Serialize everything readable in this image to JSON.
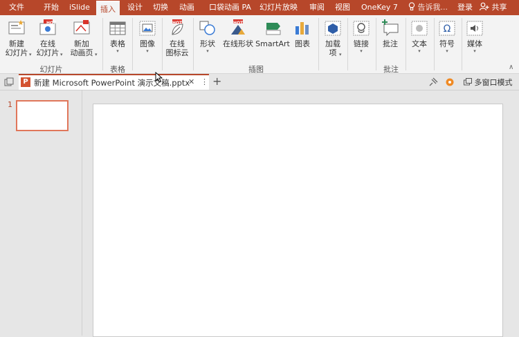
{
  "menu": {
    "tabs": [
      "文件",
      "开始",
      "iSlide",
      "插入",
      "设计",
      "切换",
      "动画",
      "口袋动画 PA",
      "幻灯片放映",
      "审阅",
      "视图",
      "OneKey 7"
    ],
    "active_tab": "插入",
    "tell_me": "告诉我...",
    "login": "登录",
    "share": "共享"
  },
  "ribbon": {
    "new_slide": [
      "新建",
      "幻灯片"
    ],
    "online_slide": [
      "在线",
      "幻灯片"
    ],
    "new_anim_page": [
      "新加",
      "动画页"
    ],
    "group_slides": "幻灯片",
    "table": "表格",
    "group_table": "表格",
    "image": "图像",
    "online_icons": [
      "在线",
      "图标云"
    ],
    "shapes": "形状",
    "online_shapes": "在线形状",
    "smartart": "SmartArt",
    "chart": "图表",
    "group_illustrations": "插图",
    "addins": [
      "加载",
      "项"
    ],
    "links": "链接",
    "comment": "批注",
    "group_comments": "批注",
    "text": "文本",
    "symbols": "符号",
    "media": "媒体",
    "hot_badge": "HOT",
    "collapse_glyph": "∧"
  },
  "doc_tab": {
    "title": "新建 Microsoft PowerPoint 演示文稿.pptx",
    "app_letter": "P",
    "close_glyph": "✕",
    "more_glyph": "⋮",
    "add_glyph": "+",
    "multi_window": "多窗口模式"
  },
  "thumbnails": {
    "slide_number": "1"
  },
  "colors": {
    "accent": "#b7472a",
    "ribbon_bg": "#f3f3f3",
    "workspace": "#e6e6e6"
  }
}
